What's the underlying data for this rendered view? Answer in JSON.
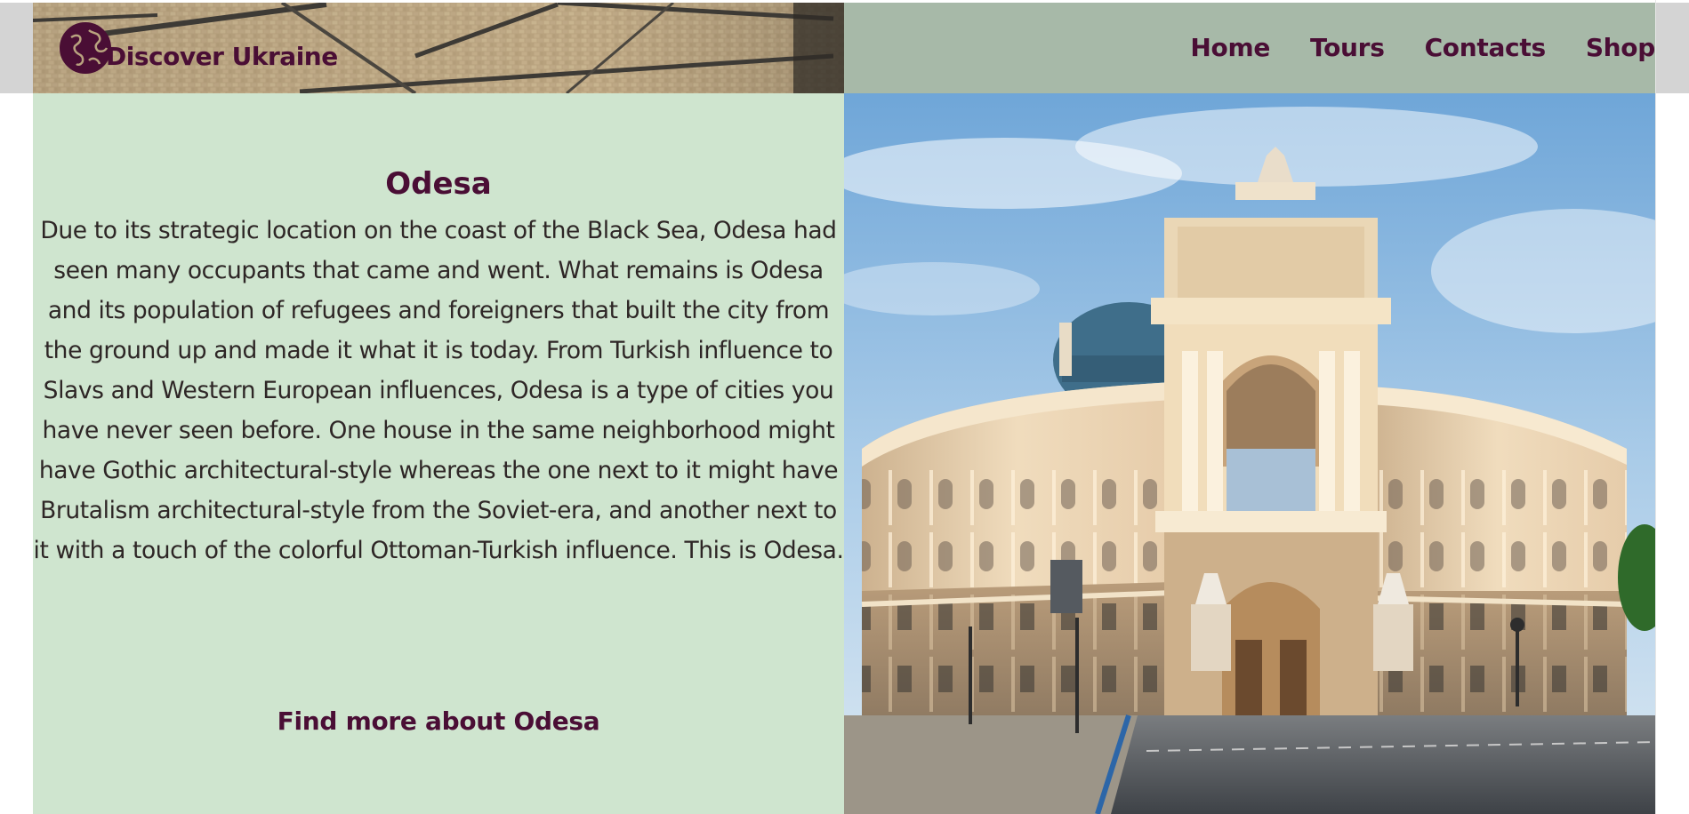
{
  "header": {
    "logo_text": "Discover Ukraine",
    "logo_icon": "globe-icon",
    "nav": [
      {
        "label": "Home"
      },
      {
        "label": "Tours"
      },
      {
        "label": "Contacts"
      },
      {
        "label": "Shop"
      }
    ]
  },
  "city": {
    "title": "Odesa",
    "description": "Due to its strategic location on the coast of the Black Sea, Odesa had seen many occupants that came and went. What remains is Odesa and its population of refugees and foreigners that built the city from the ground up and made it what it is today. From Turkish influence to Slavs and Western European influences, Odesa is a type of cities you have never seen before. One house in the same neighborhood might have Gothic architectural-style whereas the one next to it might have Brutalism architectural-style from the Soviet-era, and another next to it with a touch of the colorful Ottoman-Turkish influence. This is Odesa.",
    "link_label": "Find more about Odesa",
    "image": "odesa-opera-theatre-photo"
  },
  "colors": {
    "accent": "#4a0e35",
    "header_right_bg": "#a7b9a8",
    "content_left_bg": "#cfe5cf",
    "body_text": "#2e2626"
  }
}
